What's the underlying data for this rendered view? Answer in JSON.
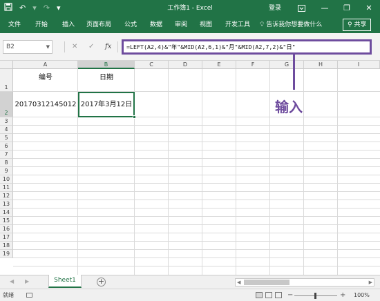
{
  "titlebar": {
    "save_icon": "save-icon",
    "undo_icon": "undo-icon",
    "redo_icon": "redo-icon",
    "customize_icon": "customize-qat-icon",
    "title": "工作簿1 - Excel",
    "login_label": "登录",
    "ribbon_options_icon": "ribbon-display-icon",
    "minimize_glyph": "—",
    "restore_glyph": "❐",
    "close_glyph": "✕"
  },
  "ribbon": {
    "tabs": [
      "文件",
      "开始",
      "插入",
      "页面布局",
      "公式",
      "数据",
      "审阅",
      "视图",
      "开发工具"
    ],
    "tell_me": "告诉我你想要做什么",
    "share_label": "共享"
  },
  "formula_bar": {
    "name_box": "B2",
    "cancel_glyph": "✕",
    "enter_glyph": "✓",
    "fx_label": "fx",
    "formula": "=LEFT(A2,4)&\"年\"&MID(A2,6,1)&\"月\"&MID(A2,7,2)&\"日\""
  },
  "grid": {
    "columns": [
      "A",
      "B",
      "C",
      "D",
      "E",
      "F",
      "G",
      "H",
      "I"
    ],
    "selected_column": "B",
    "rows": [
      "1",
      "2",
      "3",
      "4",
      "5",
      "6",
      "7",
      "8",
      "9",
      "10",
      "11",
      "12",
      "13",
      "14",
      "15",
      "16",
      "17",
      "18",
      "19"
    ],
    "selected_row": "2",
    "cells": {
      "A1": "编号",
      "B1": "日期",
      "A2": "20170312145012",
      "B2": "2017年3月12日"
    }
  },
  "annotation": {
    "label": "输入",
    "color": "#6e4c9e"
  },
  "sheets": {
    "tabs": [
      "Sheet1"
    ],
    "active": "Sheet1"
  },
  "status": {
    "ready": "就绪",
    "zoom": "100%",
    "zoom_level": 1.0
  },
  "colors": {
    "accent": "#217346",
    "annotation": "#6e4c9e"
  }
}
